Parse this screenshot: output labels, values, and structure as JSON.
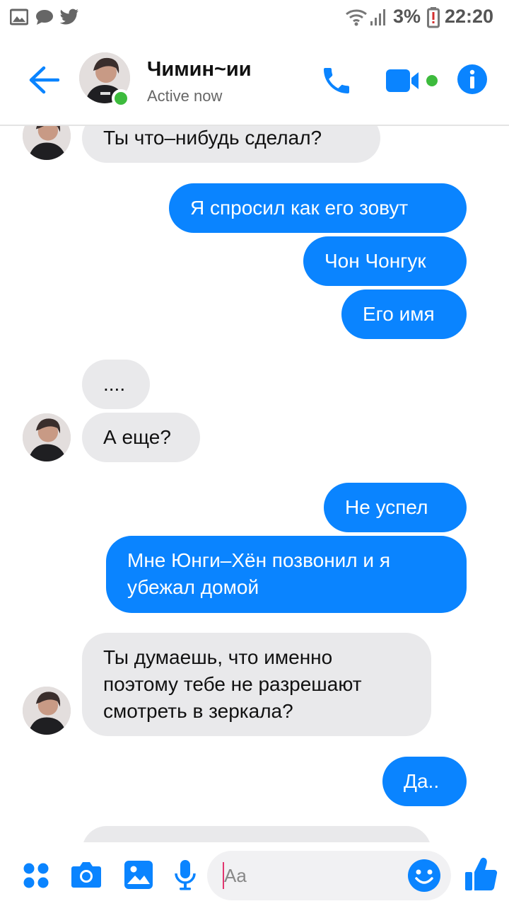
{
  "statusbar": {
    "battery": "3%",
    "time": "22:20"
  },
  "header": {
    "name": "Чимин~ии",
    "status": "Active now"
  },
  "messages": [
    {
      "side": "in",
      "text": "Ты что–нибудь сделал?"
    },
    {
      "side": "out",
      "text": "Я спросил как его зовут"
    },
    {
      "side": "out",
      "text": "Чон Чонгук"
    },
    {
      "side": "out",
      "text": "Его имя"
    },
    {
      "side": "in",
      "text": "...."
    },
    {
      "side": "in",
      "text": "А еще?"
    },
    {
      "side": "out",
      "text": "Не успел"
    },
    {
      "side": "out",
      "text": "Мне Юнги–Хён позвонил и я убежал домой"
    },
    {
      "side": "in",
      "text": "Ты думаешь, что именно поэтому тебе не разрешают смотреть в зеркала?"
    },
    {
      "side": "out",
      "text": "Да.."
    }
  ],
  "composer": {
    "placeholder": "Aa"
  },
  "colors": {
    "accent": "#0a84ff",
    "incoming": "#e9e9eb",
    "online": "#3dbb3d"
  }
}
